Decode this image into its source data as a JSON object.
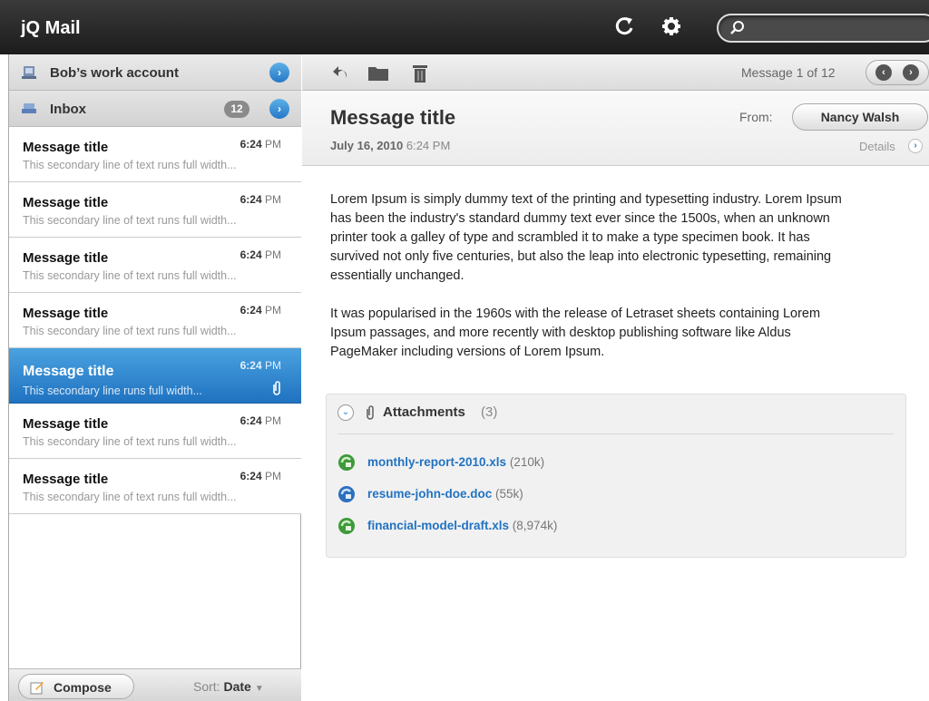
{
  "app": {
    "title": "jQ Mail"
  },
  "search": {
    "placeholder": ""
  },
  "sidebar": {
    "account": "Bob’s work account",
    "inbox": {
      "label": "Inbox",
      "count": "12"
    },
    "messages": [
      {
        "title": "Message title",
        "time_h": "6:24",
        "time_ampm": "PM",
        "preview": "This secondary line of text runs full width...",
        "selected": false,
        "attachment": false
      },
      {
        "title": "Message title",
        "time_h": "6:24",
        "time_ampm": "PM",
        "preview": "This secondary line of text runs full width...",
        "selected": false,
        "attachment": false
      },
      {
        "title": "Message title",
        "time_h": "6:24",
        "time_ampm": "PM",
        "preview": "This secondary line of text runs full width...",
        "selected": false,
        "attachment": false
      },
      {
        "title": "Message title",
        "time_h": "6:24",
        "time_ampm": "PM",
        "preview": "This secondary line of text runs full width...",
        "selected": false,
        "attachment": false
      },
      {
        "title": "Message title",
        "time_h": "6:24",
        "time_ampm": "PM",
        "preview": "This secondary line runs full width...",
        "selected": true,
        "attachment": true
      },
      {
        "title": "Message title",
        "time_h": "6:24",
        "time_ampm": "PM",
        "preview": "This secondary line of text runs full width...",
        "selected": false,
        "attachment": false
      },
      {
        "title": "Message title",
        "time_h": "6:24",
        "time_ampm": "PM",
        "preview": "This secondary line of text runs full width...",
        "selected": false,
        "attachment": false
      }
    ],
    "compose_label": "Compose",
    "sort_label": "Sort:",
    "sort_value": "Date"
  },
  "toolbar": {
    "message_count": "Message 1 of 12"
  },
  "message": {
    "subject": "Message title",
    "date": "July 16, 2010",
    "time": "6:24 PM",
    "from_label": "From:",
    "from_name": "Nancy Walsh",
    "details_label": "Details",
    "body": [
      "Lorem Ipsum is simply dummy text of the printing and typesetting industry. Lorem Ipsum has been the industry's standard dummy text ever since the 1500s, when an unknown printer took a galley of type and scrambled it to make a type specimen book. It has survived not only five centuries, but also the leap into electronic typesetting, remaining essentially unchanged.",
      "It was popularised in the 1960s with the release of Letraset sheets containing Lorem Ipsum passages, and more recently with desktop publishing software like Aldus PageMaker including versions of Lorem Ipsum."
    ]
  },
  "attachments": {
    "title": "Attachments",
    "count": "(3)",
    "files": [
      {
        "name": "monthly-report-2010.xls",
        "size": "(210k)",
        "icon": "spreadsheet-icon"
      },
      {
        "name": "resume-john-doe.doc",
        "size": "(55k)",
        "icon": "word-doc-icon"
      },
      {
        "name": "financial-model-draft.xls",
        "size": "(8,974k)",
        "icon": "spreadsheet-icon"
      }
    ]
  },
  "colors": {
    "accent": "#2578c7",
    "link": "#2273c2",
    "topbar": "#1c1c1c"
  }
}
